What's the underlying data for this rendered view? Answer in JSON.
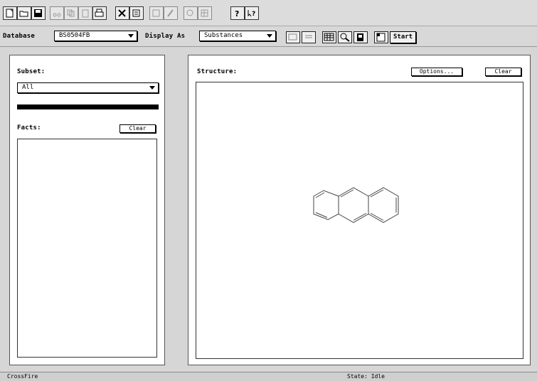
{
  "toolbar": {
    "database_label": "Database",
    "database_value": "BS0504FB",
    "display_as_label": "Display As",
    "display_as_value": "Substances",
    "start_label": "Start"
  },
  "left_panel": {
    "subset_label": "Subset:",
    "subset_value": "All",
    "progress": 1.0,
    "facts_label": "Facts:",
    "clear_label": "Clear"
  },
  "right_panel": {
    "structure_label": "Structure:",
    "options_label": "Options...",
    "clear_label": "Clear"
  },
  "statusbar": {
    "left_text": "CrossFire",
    "middle_text": "State: Idle"
  },
  "icons": [
    "new-file-icon",
    "open-folder-icon",
    "save-icon",
    "cut-icon",
    "copy-icon",
    "paste-icon",
    "print-icon",
    "query-icon",
    "hit-list-icon",
    "edit-icon",
    "pencil-icon",
    "record-icon",
    "table-icon",
    "help-icon",
    "context-help-icon",
    "structure-view-icon",
    "text-view-icon",
    "grid-view-icon",
    "magnifier-icon",
    "document-icon",
    "page-icon"
  ]
}
